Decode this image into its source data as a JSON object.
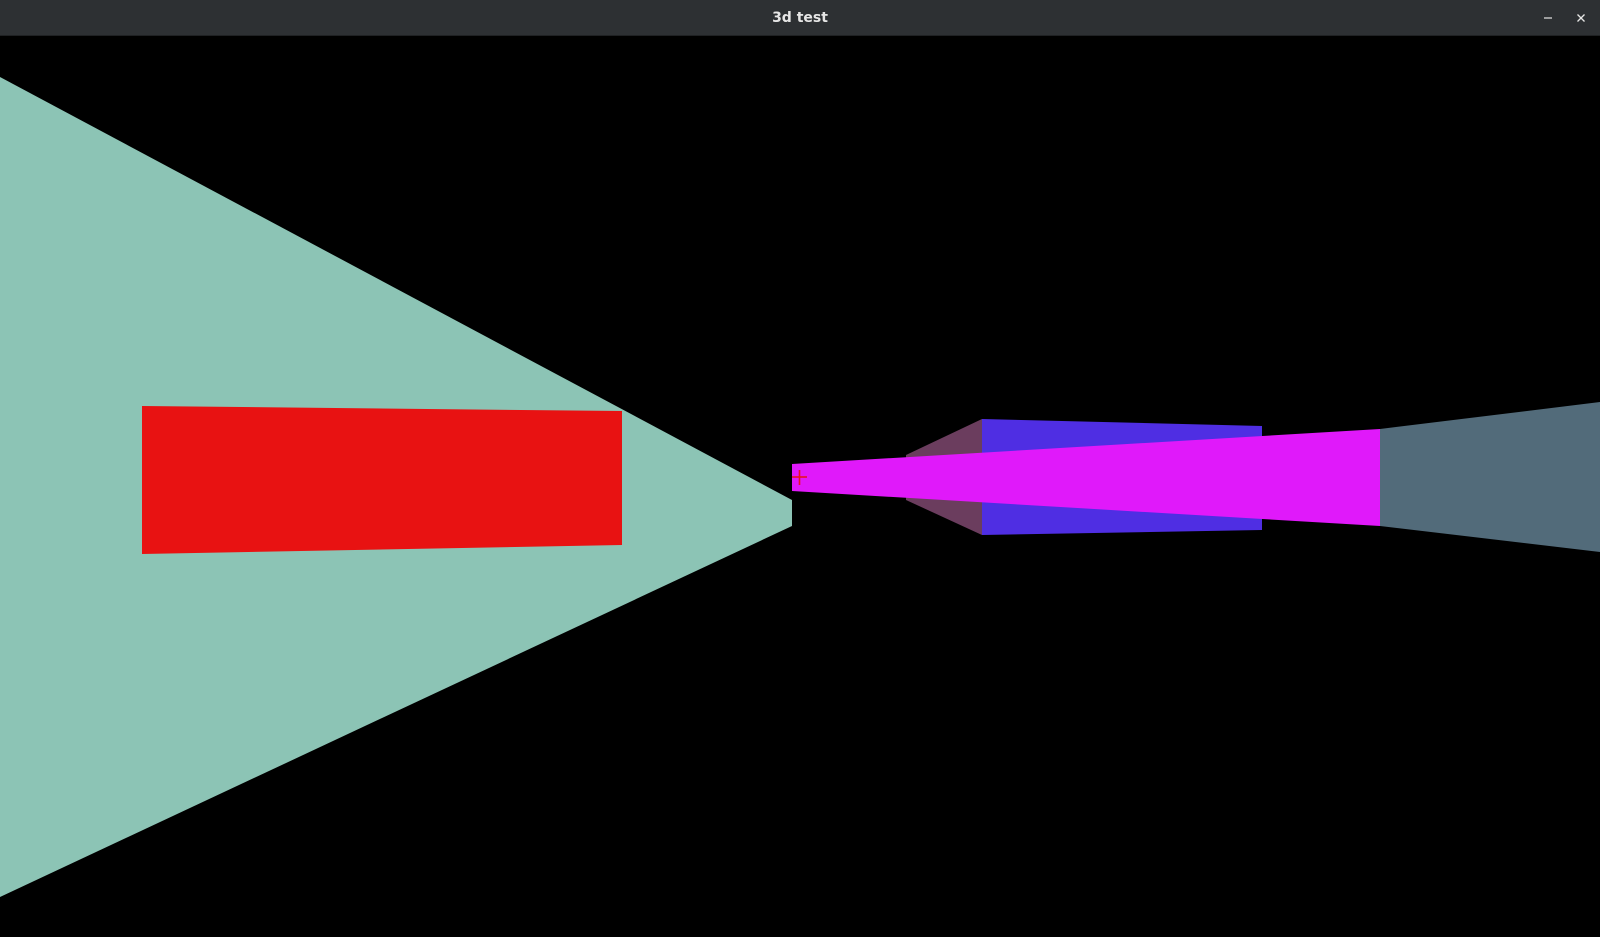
{
  "window": {
    "title": "3d test",
    "minimize_icon": "minimize-icon",
    "close_icon": "close-icon"
  },
  "scene": {
    "background_color": "#000000",
    "crosshair_icon": "crosshair-icon",
    "crosshair_color": "#e8121f",
    "objects": [
      {
        "name": "green-wall-face",
        "color": "#8cc4b5"
      },
      {
        "name": "red-panel",
        "color": "#e81212"
      },
      {
        "name": "dark-red-cap-face",
        "color": "#6b3d5e"
      },
      {
        "name": "blue-prism-face",
        "color": "#4f2ee3"
      },
      {
        "name": "magenta-beam-face",
        "color": "#e019fa"
      },
      {
        "name": "slate-block-face",
        "color": "#526b7a"
      }
    ]
  }
}
